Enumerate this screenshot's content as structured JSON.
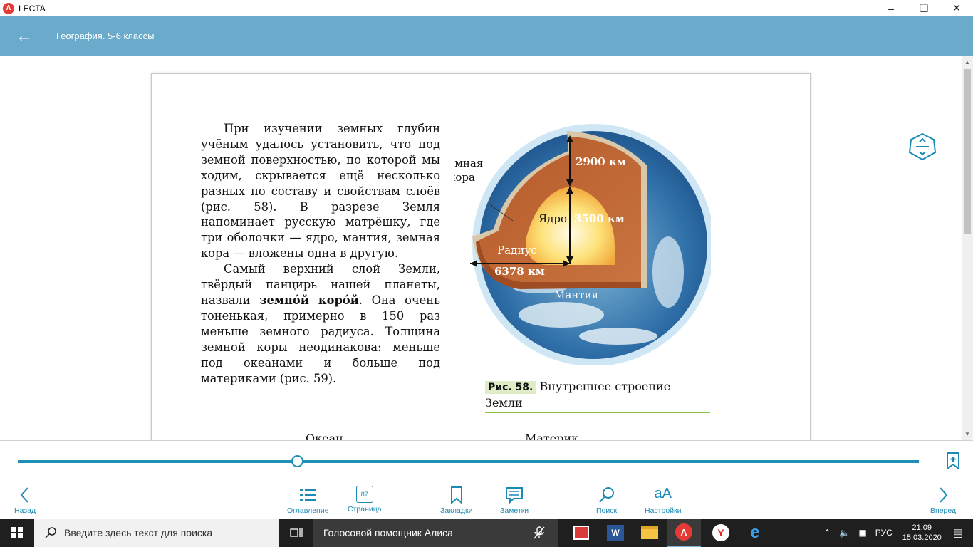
{
  "window": {
    "app_name": "LECTA"
  },
  "header": {
    "book_title": "География. 5-6 классы"
  },
  "page": {
    "paragraph1": "При изучении земных глубин учёным удалось установить, что под земной поверхностью, по которой мы ходим, скрывается ещё несколько разных по составу и свойствам слоёв (рис. 58). В разрезе Земля напоминает русскую матрёшку, где три оболочки — ядро, мантия, земная кора — вложены одна в другую.",
    "paragraph2_start": "Самый верхний слой Земли, твёрдый панцирь нашей планеты, назвали ",
    "paragraph2_term": "земно́й коро́й",
    "paragraph2_end": ". Она очень тоненькая, примерно в 150 раз меньше земного радиуса. Толщина земной коры неодинакова: меньше под океанами и больше под материками (рис. 59).",
    "figure": {
      "label_crust": "Земная кора",
      "label_2900": "2900 км",
      "label_core": "Ядро",
      "label_3500": "3500 км",
      "label_radius": "Радиус",
      "label_6378": "6378 км",
      "label_mantle": "Мантия"
    },
    "caption_label": "Рис. 58.",
    "caption_text": " Внутреннее строение Земли",
    "cut_left": "Океан",
    "cut_right": "Материк"
  },
  "nav": {
    "back": "Назад",
    "contents": "Оглавление",
    "page": "Страница",
    "page_number": "87",
    "bookmarks": "Закладки",
    "notes": "Заметки",
    "search": "Поиск",
    "settings": "Настройки",
    "forward": "Вперед"
  },
  "progress": {
    "value_percent": 31
  },
  "taskbar": {
    "search_placeholder": "Введите здесь текст для поиска",
    "assistant": "Голосовой помощник Алиса",
    "lang": "РУС",
    "time": "21:09",
    "date": "15.03.2020"
  },
  "colors": {
    "header": "#6aaacb",
    "accent": "#1f8fb5",
    "caption_rule": "#8cc63f"
  }
}
